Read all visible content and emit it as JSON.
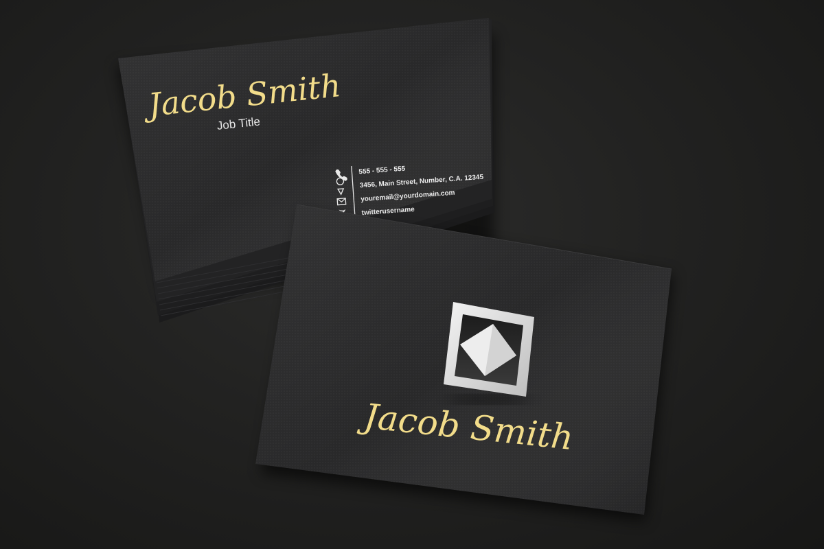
{
  "back_card": {
    "name": "Jacob Smith",
    "job_title": "Job Title",
    "contacts": [
      {
        "icon": "phone-icon",
        "text": "555 - 555 - 555"
      },
      {
        "icon": "location-pin-icon",
        "text": "3456, Main Street, Number, C.A. 12345"
      },
      {
        "icon": "envelope-icon",
        "text": "youremail@yourdomain.com"
      },
      {
        "icon": "twitter-icon",
        "text": "twitterusername"
      }
    ]
  },
  "front_card": {
    "name": "Jacob Smith",
    "logo": "diamond-in-square-logo"
  },
  "colors": {
    "background": "#1f1f1e",
    "card": "#2a2a2b",
    "gold": "#f2dc8a",
    "white": "#e8e8e8"
  }
}
